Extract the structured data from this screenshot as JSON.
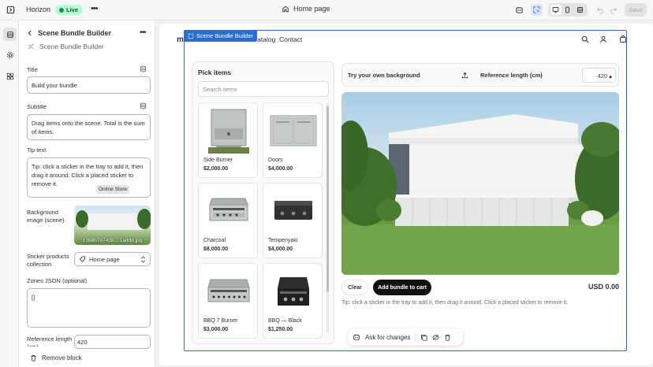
{
  "topbar": {
    "app_name": "Horizon",
    "live_label": "Live",
    "page_label": "Home page",
    "save_label": "Save"
  },
  "panel": {
    "title": "Scene Bundle Builder",
    "subtitle": "Scene Bundle Builder",
    "fields": {
      "title_label": "Title",
      "title_value": "Build your bundle",
      "subtitle_label": "Subtitle",
      "subtitle_value": "Drag items onto the scene. Total is the sum of items.",
      "tip_label": "Tip text",
      "tip_value": "Tip: click a sticker in the tray to add it, then drag it around. Click a placed sticker to remove it.",
      "tooltip": "Online Store",
      "bg_label": "Background image (scene)",
      "bg_filename": "13b8b797459... 1addd.jpg",
      "sticker_label": "Sticker products collection",
      "sticker_value": "Home page",
      "zones_label": "Zones JSON (optional)",
      "zones_value": "[]",
      "ref_label": "Reference length (cm)",
      "ref_value": "420"
    },
    "remove_label": "Remove block"
  },
  "store": {
    "brand_partial": "m",
    "nav": [
      "Catalog",
      "Contact"
    ]
  },
  "block_tag": "Scene Bundle Builder",
  "picker": {
    "title": "Pick items",
    "search_placeholder": "Search items",
    "items": [
      {
        "name": "Side Burner",
        "price": "$2,000.00",
        "icon": "side-burner"
      },
      {
        "name": "Doors",
        "price": "$4,000.00",
        "icon": "doors"
      },
      {
        "name": "Charcoal",
        "price": "$8,000.00",
        "icon": "charcoal-grill"
      },
      {
        "name": "Tempenyaki",
        "price": "$4,000.00",
        "icon": "teppanyaki"
      },
      {
        "name": "BBQ 7 Burner",
        "price": "$3,000.00",
        "icon": "bbq-7-burner"
      },
      {
        "name": "BBQ — Black",
        "price": "$1,250.00",
        "icon": "bbq-black"
      }
    ]
  },
  "scene_controls": {
    "bg_label": "Try your own background",
    "ref_label": "Reference length (cm)",
    "ref_value": "420"
  },
  "actions": {
    "clear": "Clear",
    "add_to_cart": "Add bundle to cart",
    "total": "USD 0.00",
    "tip": "Tip: click a sticker in the tray to add it, then drag it around. Click a placed sticker to remove it."
  },
  "ask_bar": {
    "label": "Ask for changes"
  }
}
